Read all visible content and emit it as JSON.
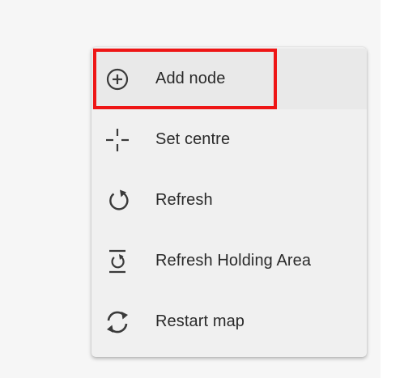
{
  "menu": {
    "items": [
      {
        "label": "Add node",
        "icon": "add-circle-icon"
      },
      {
        "label": "Set centre",
        "icon": "crosshair-icon"
      },
      {
        "label": "Refresh",
        "icon": "refresh-icon"
      },
      {
        "label": "Refresh Holding Area",
        "icon": "refresh-holding-area-icon"
      },
      {
        "label": "Restart map",
        "icon": "restart-icon"
      }
    ],
    "highlighted_item": "Add node"
  },
  "colors": {
    "menu_background": "#f0f0f0",
    "highlight_border": "#ee1515",
    "icon_color": "#3a3a3a",
    "text_color": "#2a2a2a"
  }
}
